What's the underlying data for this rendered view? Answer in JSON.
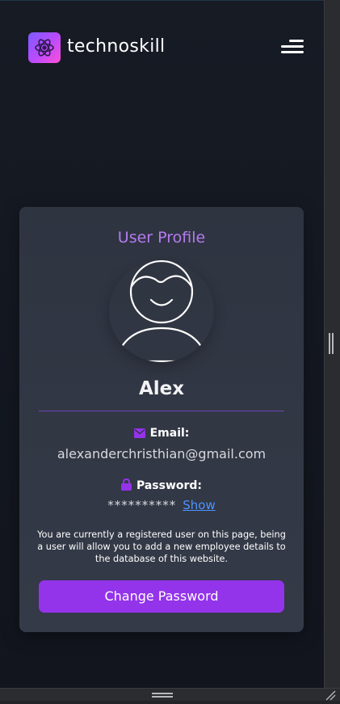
{
  "header": {
    "brand": "technoskill",
    "logo_icon": "atom-icon",
    "menu_icon": "hamburger-menu-icon"
  },
  "profile": {
    "title": "User Profile",
    "avatar_icon": "user-avatar-icon",
    "name": "Alex",
    "email_label": "Email:",
    "email_icon": "envelope-icon",
    "email": "alexanderchristhian@gmail.com",
    "password_label": "Password:",
    "password_icon": "lock-icon",
    "password_masked": "**********",
    "show_label": "Show",
    "info": "You are currently a registered user on this page, being a user will allow you to add a new employee details to the database of this website.",
    "change_password_label": "Change Password"
  },
  "colors": {
    "accent": "#9333ea",
    "title": "#b57bf0",
    "link": "#4c93ff",
    "card": "#343a47",
    "background": "#141821"
  }
}
